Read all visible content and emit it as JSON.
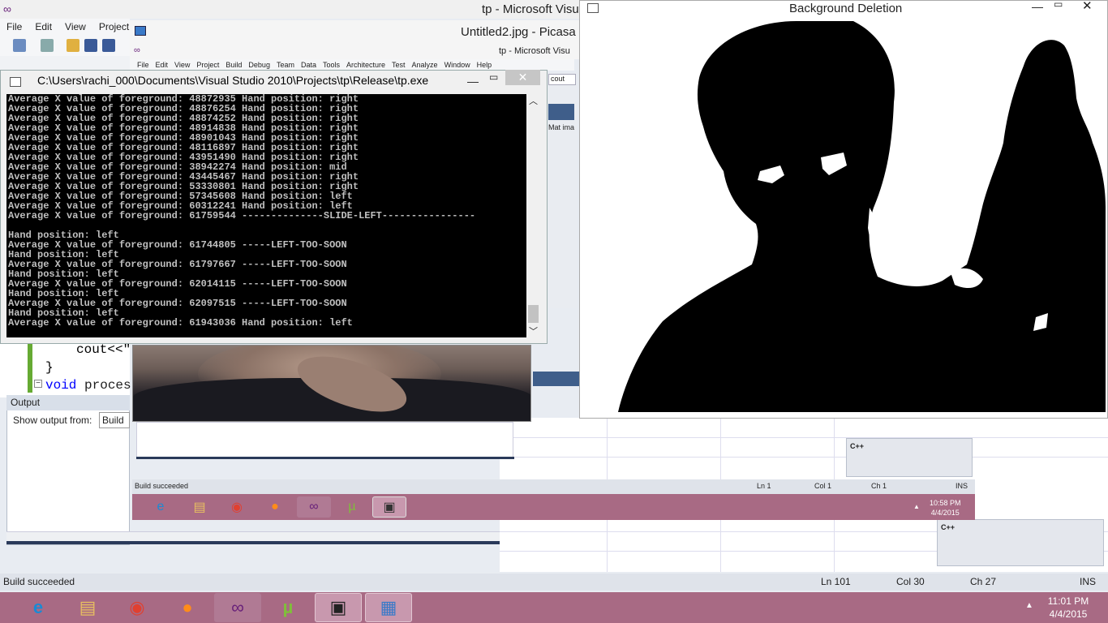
{
  "vs_main": {
    "title": "tp - Microsoft Visu",
    "menu": [
      "File",
      "Edit",
      "View",
      "Project"
    ],
    "code": {
      "line1": "cout<<\"",
      "line2": "}",
      "line3_kw": "void",
      "line3_rest": " proces"
    },
    "output": {
      "header": "Output",
      "show_from_label": "Show output from:",
      "show_from_value": "Build"
    },
    "status": {
      "message": "Build succeeded",
      "ln": "Ln 101",
      "col": "Col 30",
      "ch": "Ch 27",
      "ins": "INS"
    }
  },
  "picasa": {
    "title": "Untitled2.jpg - Picasa P"
  },
  "vs_inner": {
    "title": "tp - Microsoft Visu",
    "menu": [
      "File",
      "Edit",
      "View",
      "Project",
      "Build",
      "Debug",
      "Team",
      "Data",
      "Tools",
      "Architecture",
      "Test",
      "Analyze",
      "Window",
      "Help"
    ],
    "cout_field": "cout",
    "mat_label": "Mat ima",
    "cpp_label_1": "C++",
    "cpp_label_2": "C++",
    "status": {
      "message": "Build succeeded",
      "ln": "Ln 1",
      "col": "Col 1",
      "ch": "Ch 1",
      "ins": "INS"
    },
    "clock_time": "10:58 PM",
    "clock_date": "4/4/2015"
  },
  "console": {
    "title": "C:\\Users\\rachi_000\\Documents\\Visual Studio 2010\\Projects\\tp\\Release\\tp.exe",
    "lines": [
      "Average X value of foreground: 48872935 Hand position: right",
      "Average X value of foreground: 48876254 Hand position: right",
      "Average X value of foreground: 48874252 Hand position: right",
      "Average X value of foreground: 48914838 Hand position: right",
      "Average X value of foreground: 48901043 Hand position: right",
      "Average X value of foreground: 48116897 Hand position: right",
      "Average X value of foreground: 43951490 Hand position: right",
      "Average X value of foreground: 38942274 Hand position: mid",
      "Average X value of foreground: 43445467 Hand position: right",
      "Average X value of foreground: 53330801 Hand position: right",
      "Average X value of foreground: 57345608 Hand position: left",
      "Average X value of foreground: 60312241 Hand position: left",
      "Average X value of foreground: 61759544 --------------SLIDE-LEFT----------------",
      "",
      "Hand position: left",
      "Average X value of foreground: 61744805 -----LEFT-TOO-SOON",
      "Hand position: left",
      "Average X value of foreground: 61797667 -----LEFT-TOO-SOON",
      "Hand position: left",
      "Average X value of foreground: 62014115 -----LEFT-TOO-SOON",
      "Hand position: left",
      "Average X value of foreground: 62097515 -----LEFT-TOO-SOON",
      "Hand position: left",
      "Average X value of foreground: 61943036 Hand position: left"
    ]
  },
  "bg_deletion": {
    "title": "Background Deletion"
  },
  "taskbar": {
    "clock_time": "11:01 PM",
    "clock_date": "4/4/2015",
    "apps": [
      "internet-explorer-icon",
      "file-explorer-icon",
      "chrome-icon",
      "firefox-icon",
      "visual-studio-icon",
      "utorrent-icon",
      "console-app-icon",
      "picasa-icon"
    ]
  },
  "colors": {
    "taskbar": "#a86a84",
    "vs_blue": "#3f5e8a",
    "console_bg": "#000000",
    "console_fg": "#c0c0c0"
  }
}
